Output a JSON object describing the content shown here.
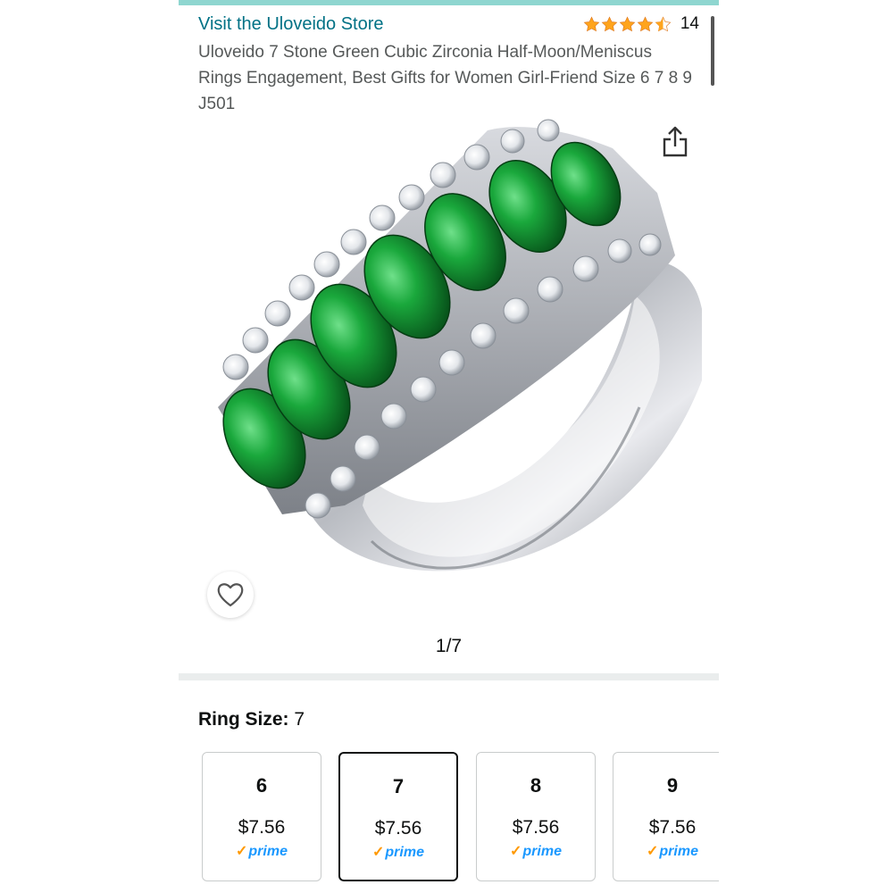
{
  "store": {
    "link_text": "Visit the Uloveido Store"
  },
  "rating": {
    "stars": 4.5,
    "count": "14",
    "star_color": "#ffa41c"
  },
  "product": {
    "title": "Uloveido 7 Stone Green Cubic Zirconia Half-Moon/Meniscus Rings Engagement, Best Gifts for Women Girl-Friend Size 6 7 8 9 J501",
    "image_counter": "1/7"
  },
  "icons": {
    "share": "share-icon",
    "wishlist": "heart-icon"
  },
  "variation": {
    "label": "Ring Size:",
    "selected_value": "7"
  },
  "sizes": [
    {
      "size": "6",
      "price": "$7.56",
      "badge": "prime",
      "selected": false
    },
    {
      "size": "7",
      "price": "$7.56",
      "badge": "prime",
      "selected": true
    },
    {
      "size": "8",
      "price": "$7.56",
      "badge": "prime",
      "selected": false
    },
    {
      "size": "9",
      "price": "$7.56",
      "badge": "prime",
      "selected": false
    }
  ],
  "colors": {
    "link": "#007185",
    "prime_blue": "#1a98ff",
    "prime_check": "#ff9900",
    "emerald": "#0f8a2a"
  }
}
